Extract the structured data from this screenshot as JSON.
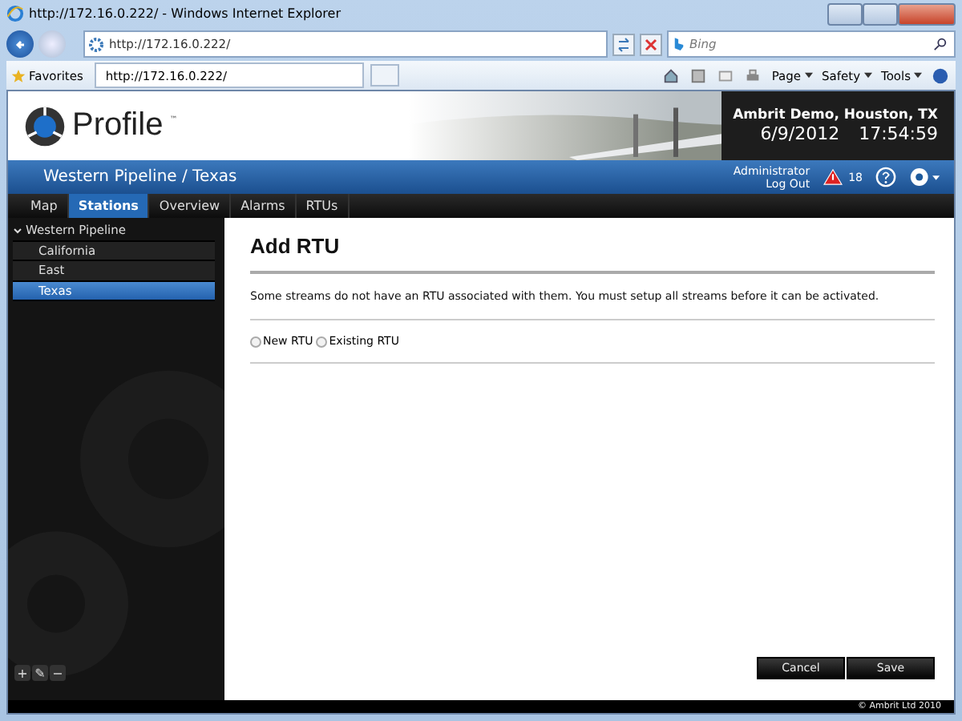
{
  "window": {
    "title": "http://172.16.0.222/ - Windows Internet Explorer"
  },
  "address_bar": {
    "value": "http://172.16.0.222/"
  },
  "search": {
    "placeholder": "Bing"
  },
  "favorites_label": "Favorites",
  "browser_tab": {
    "title": "http://172.16.0.222/"
  },
  "command_menus": [
    "Page",
    "Safety",
    "Tools"
  ],
  "header": {
    "logo_text": "Profile",
    "trademark": "™",
    "site": "Ambrit Demo, Houston, TX",
    "date": "6/9/2012",
    "time": "17:54:59"
  },
  "breadcrumb": "Western Pipeline / Texas",
  "user": {
    "name": "Administrator",
    "logout": "Log Out"
  },
  "alarm_count": "18",
  "nav_tabs": [
    {
      "label": "Map",
      "selected": false
    },
    {
      "label": "Stations",
      "selected": true
    },
    {
      "label": "Overview",
      "selected": false
    },
    {
      "label": "Alarms",
      "selected": false
    },
    {
      "label": "RTUs",
      "selected": false
    }
  ],
  "tree": [
    {
      "label": "Western Pipeline",
      "expanded": true,
      "selected": false,
      "children": [
        {
          "label": "California",
          "selected": false
        },
        {
          "label": "East",
          "selected": false
        },
        {
          "label": "Texas",
          "selected": true
        }
      ]
    }
  ],
  "tree_tools": [
    "+",
    "✎",
    "−"
  ],
  "page_title": "Add RTU",
  "message": "Some streams do not have an RTU associated with them. You must setup all streams before it can be activated.",
  "radios": [
    {
      "label": "New RTU",
      "selected": false
    },
    {
      "label": "Existing RTU",
      "selected": false
    }
  ],
  "buttons": [
    "Cancel",
    "Save"
  ],
  "footer": "© Ambrit Ltd 2010"
}
